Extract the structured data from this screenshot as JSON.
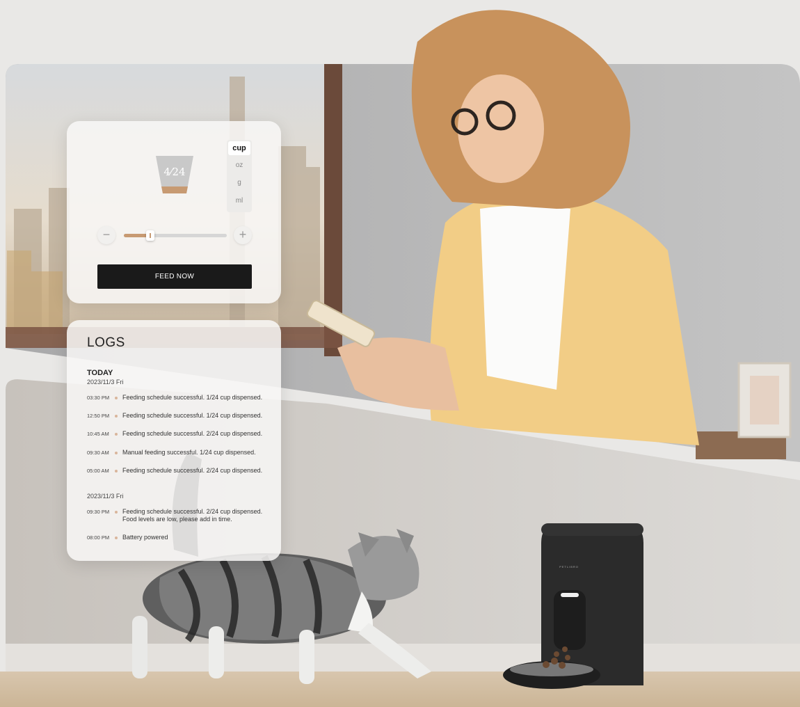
{
  "feed_panel": {
    "portion_fraction": "4⁄24",
    "portion_value": 0.1667,
    "units": [
      "cup",
      "oz",
      "g",
      "ml"
    ],
    "selected_unit": "cup",
    "decrease_symbol": "−",
    "increase_symbol": "+",
    "feed_button_label": "FEED NOW"
  },
  "logs": {
    "title": "LOGS",
    "today_label": "TODAY",
    "groups": [
      {
        "date": "2023/11/3  Fri",
        "entries": [
          {
            "time": "03:30 PM",
            "text": "Feeding schedule successful. 1/24 cup dispensed."
          },
          {
            "time": "12:50 PM",
            "text": "Feeding schedule successful. 1/24 cup dispensed."
          },
          {
            "time": "10:45 AM",
            "text": "Feeding schedule successful. 2/24 cup dispensed."
          },
          {
            "time": "09:30 AM",
            "text": "Manual feeding successful. 1/24 cup dispensed."
          },
          {
            "time": "05:00 AM",
            "text": "Feeding schedule successful. 2/24 cup dispensed."
          }
        ]
      },
      {
        "date": "2023/11/3  Fri",
        "entries": [
          {
            "time": "09:30 PM",
            "text": "Feeding schedule successful. 2/24 cup dispensed. Food levels are low, please add in time."
          },
          {
            "time": "08:00 PM",
            "text": "Battery powered"
          }
        ]
      }
    ]
  },
  "device": {
    "brand_label": "PETLIBRO"
  },
  "colors": {
    "accent": "#c79a72",
    "button": "#1a1a1a",
    "feeder": "#2b2b2b"
  }
}
